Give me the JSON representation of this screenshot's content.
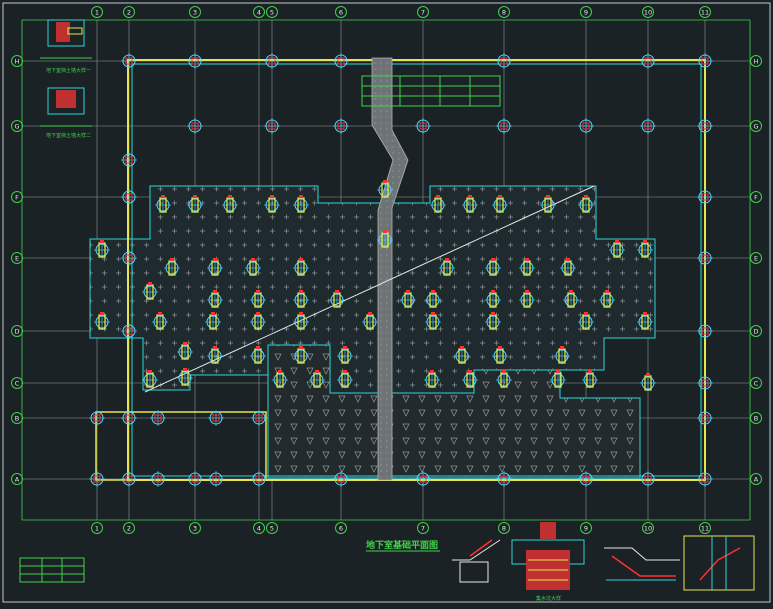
{
  "drawing": {
    "title": "地下室基础平面图",
    "background": "#1b2226",
    "colors": {
      "grid": "#9aa3a8",
      "axis": "#3fd24a",
      "wall": "#e6e64a",
      "slab": "#2bd6d6",
      "hatch": "#a0a6a8",
      "ramp": "#7b7f82",
      "pile": "#4fd7ff",
      "red": "#ff3030",
      "yellow": "#f0f03a",
      "white": "#ffffff",
      "blue": "#2f5cff"
    },
    "axes_columns": [
      "1",
      "2",
      "3",
      "4",
      "5",
      "6",
      "7",
      "8",
      "9",
      "10",
      "11"
    ],
    "axes_rows": [
      "H",
      "G",
      "F",
      "E",
      "D",
      "C",
      "B",
      "A"
    ],
    "side_notes": [
      "地下室挡土墙大样一",
      "地下室挡土墙大样二"
    ],
    "detail_captions": [
      "集水坑大样"
    ]
  }
}
